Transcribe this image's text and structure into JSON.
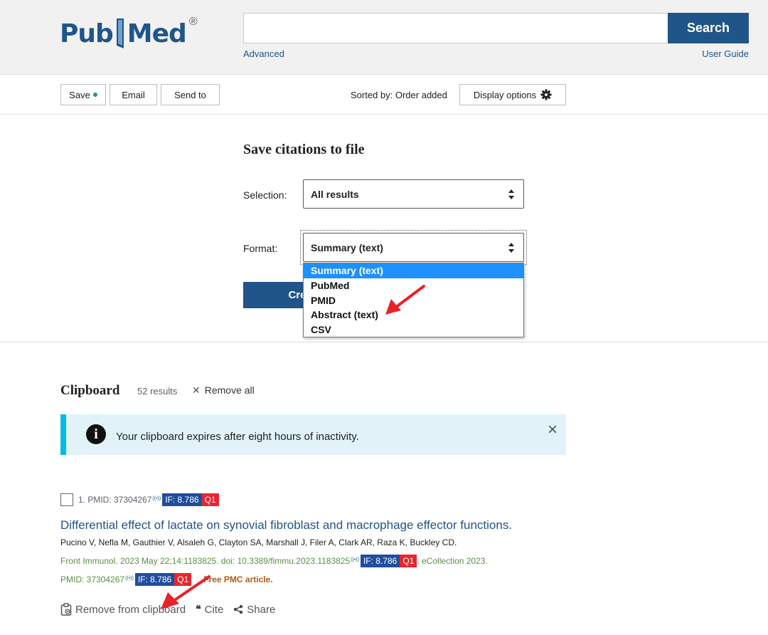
{
  "header": {
    "logo_text_left": "Pub",
    "logo_text_right": "Med",
    "logo_registered": "®",
    "search_value": "",
    "search_button": "Search",
    "advanced_link": "Advanced",
    "user_guide_link": "User Guide"
  },
  "toolbar": {
    "save_label": "Save",
    "email_label": "Email",
    "send_to_label": "Send to",
    "sorted_label": "Sorted by: Order added",
    "display_options_label": "Display options"
  },
  "save_panel": {
    "title": "Save citations to file",
    "selection_label": "Selection:",
    "selection_value": "All results",
    "format_label": "Format:",
    "format_value": "Summary (text)",
    "create_button": "Create file",
    "format_options": [
      "Summary (text)",
      "PubMed",
      "PMID",
      "Abstract (text)",
      "CSV"
    ],
    "selected_index": 0
  },
  "clipboard": {
    "title": "Clipboard",
    "count": "52 results",
    "remove_all": "Remove all",
    "notice": "Your clipboard expires after eight hours of inactivity.",
    "notice_close": "×"
  },
  "result": {
    "number_pmid": "1. PMID: 37304267",
    "if_label": "IF: 8.786",
    "quartile": "Q1",
    "title": "Differential effect of lactate on synovial fibroblast and macrophage effector functions.",
    "authors": "Pucino V, Nefla M, Gauthier V, Alsaleh G, Clayton SA, Marshall J, Filer A, Clark AR, Raza K, Buckley CD.",
    "citation": "Front Immunol. 2023 May 22;14:1183825. doi: 10.3389/fimmu.2023.1183825",
    "ecollection": ". eCollection 2023.",
    "pmid_line": "PMID: 37304267",
    "free_pmc": "Free PMC article.",
    "remove_from_clipboard": "Remove from clipboard",
    "cite": "Cite",
    "share": "Share"
  },
  "colors": {
    "brand": "#20558a",
    "if_badge": "#1f4e9e",
    "quartile_badge": "#e8262d",
    "notice_bg": "#e1f3f8",
    "notice_border": "#00bde3",
    "annotation_arrow": "#e8232a"
  }
}
